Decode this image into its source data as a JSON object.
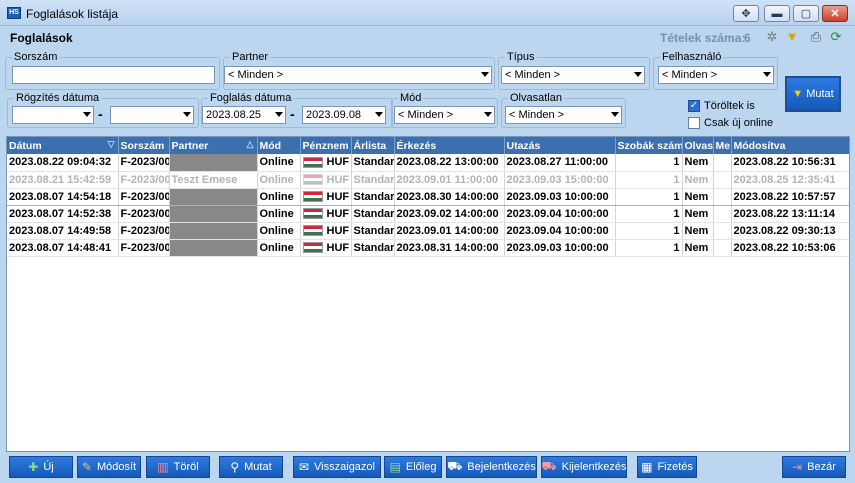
{
  "window": {
    "title": "Foglalások listája"
  },
  "header": {
    "title": "Foglalások",
    "count_label": "Tételek száma:",
    "count_value": "6"
  },
  "filters": {
    "sorszam": {
      "label": "Sorszám",
      "value": ""
    },
    "partner": {
      "label": "Partner",
      "value": "< Minden >"
    },
    "tipus": {
      "label": "Típus",
      "value": "< Minden >"
    },
    "felhasznalo": {
      "label": "Felhasználó",
      "value": "< Minden >"
    },
    "rogzites": {
      "label": "Rögzítés dátuma",
      "from": "",
      "to": ""
    },
    "foglalas": {
      "label": "Foglalás dátuma",
      "from": "2023.08.25",
      "to": "2023.09.08"
    },
    "mod": {
      "label": "Mód",
      "value": "< Minden >"
    },
    "olvasatlan": {
      "label": "Olvasatlan",
      "value": "< Minden >"
    },
    "toroltek": {
      "label": "Töröltek is",
      "checked": true
    },
    "csak_online": {
      "label": "Csak új online",
      "checked": false
    },
    "mutat_label": "Mutat"
  },
  "table": {
    "columns": [
      "Dátum",
      "Sorszám",
      "Partner",
      "Mód",
      "Pénznem",
      "Árlista",
      "Érkezés",
      "Utazás",
      "Szobák száma",
      "Olvasv",
      "Me",
      "Módosítva"
    ],
    "rows": [
      {
        "datum": "2023.08.22 09:04:32",
        "sorszam": "F-2023/00",
        "partner": "",
        "mod": "Online",
        "penznem": "HUF",
        "arlista": "Standard",
        "erkezes": "2023.08.22 13:00:00",
        "utazas": "2023.08.27 11:00:00",
        "szobak": "1",
        "olvasva": "Nem",
        "me": "",
        "modositva": "2023.08.22 10:56:31"
      },
      {
        "datum": "2023.08.21 15:42:59",
        "sorszam": "F-2023/00",
        "partner": "Teszt Emese",
        "mod": "Online",
        "penznem": "HUF",
        "arlista": "Standard",
        "erkezes": "2023.09.01 11:00:00",
        "utazas": "2023.09.03 15:00:00",
        "szobak": "1",
        "olvasva": "Nem",
        "me": "",
        "modositva": "2023.08.25 12:35:41"
      },
      {
        "datum": "2023.08.07 14:54:18",
        "sorszam": "F-2023/00",
        "partner": "",
        "mod": "Online",
        "penznem": "HUF",
        "arlista": "Standard",
        "erkezes": "2023.08.30 14:00:00",
        "utazas": "2023.09.03 10:00:00",
        "szobak": "1",
        "olvasva": "Nem",
        "me": "",
        "modositva": "2023.08.22 10:57:57"
      },
      {
        "datum": "2023.08.07 14:52:38",
        "sorszam": "F-2023/00",
        "partner": "",
        "mod": "Online",
        "penznem": "HUF",
        "arlista": "Standard",
        "erkezes": "2023.09.02 14:00:00",
        "utazas": "2023.09.04 10:00:00",
        "szobak": "1",
        "olvasva": "Nem",
        "me": "",
        "modositva": "2023.08.22 13:11:14"
      },
      {
        "datum": "2023.08.07 14:49:58",
        "sorszam": "F-2023/00",
        "partner": "",
        "mod": "Online",
        "penznem": "HUF",
        "arlista": "Standard",
        "erkezes": "2023.09.01 14:00:00",
        "utazas": "2023.09.04 10:00:00",
        "szobak": "1",
        "olvasva": "Nem",
        "me": "",
        "modositva": "2023.08.22 09:30:13"
      },
      {
        "datum": "2023.08.07 14:48:41",
        "sorszam": "F-2023/00",
        "partner": "",
        "mod": "Online",
        "penznem": "HUF",
        "arlista": "Standard",
        "erkezes": "2023.08.31 14:00:00",
        "utazas": "2023.09.03 10:00:00",
        "szobak": "1",
        "olvasva": "Nem",
        "me": "",
        "modositva": "2023.08.22 10:53:06"
      }
    ]
  },
  "toolbar": {
    "uj": "Új",
    "modosit": "Módosít",
    "torol": "Töröl",
    "mutat": "Mutat",
    "visszaigazol": "Visszaigazol",
    "eloleg": "Előleg",
    "bejelentkezes": "Bejelentkezés",
    "kijelentkezes": "Kijelentkezés",
    "fizetes": "Fizetés",
    "bezar": "Bezár"
  },
  "colors": {
    "accent": "#1559b8",
    "header_bg": "#3a6fb0",
    "panel_bg": "#bcd6f0"
  }
}
